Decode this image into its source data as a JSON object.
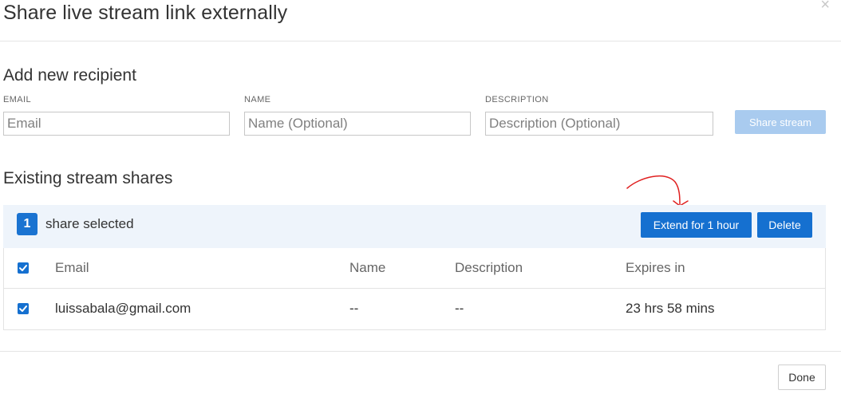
{
  "modal": {
    "title": "Share live stream link externally",
    "close_symbol": "×"
  },
  "add_recipient": {
    "heading": "Add new recipient",
    "email_label": "EMAIL",
    "email_placeholder": "Email",
    "email_value": "",
    "name_label": "NAME",
    "name_placeholder": "Name (Optional)",
    "name_value": "",
    "description_label": "DESCRIPTION",
    "description_placeholder": "Description (Optional)",
    "description_value": "",
    "share_button": "Share stream"
  },
  "existing_shares": {
    "heading": "Existing stream shares",
    "selected_count": "1",
    "selected_text": "share selected",
    "extend_button": "Extend for 1 hour",
    "delete_button": "Delete",
    "columns": {
      "email": "Email",
      "name": "Name",
      "description": "Description",
      "expires": "Expires in"
    },
    "rows": [
      {
        "email": "luissabala@gmail.com",
        "name": "--",
        "description": "--",
        "expires": "23 hrs 58 mins",
        "checked": true
      }
    ]
  },
  "footer": {
    "done_button": "Done"
  },
  "colors": {
    "primary": "#1570d0",
    "primary_disabled": "#a9cbef",
    "selection_bg": "#eef4fb",
    "annotation": "#e02020"
  },
  "icons": {
    "close": "close-icon",
    "checkbox": "checkbox-checked-icon",
    "annotation": "curved-arrow-annotation"
  }
}
